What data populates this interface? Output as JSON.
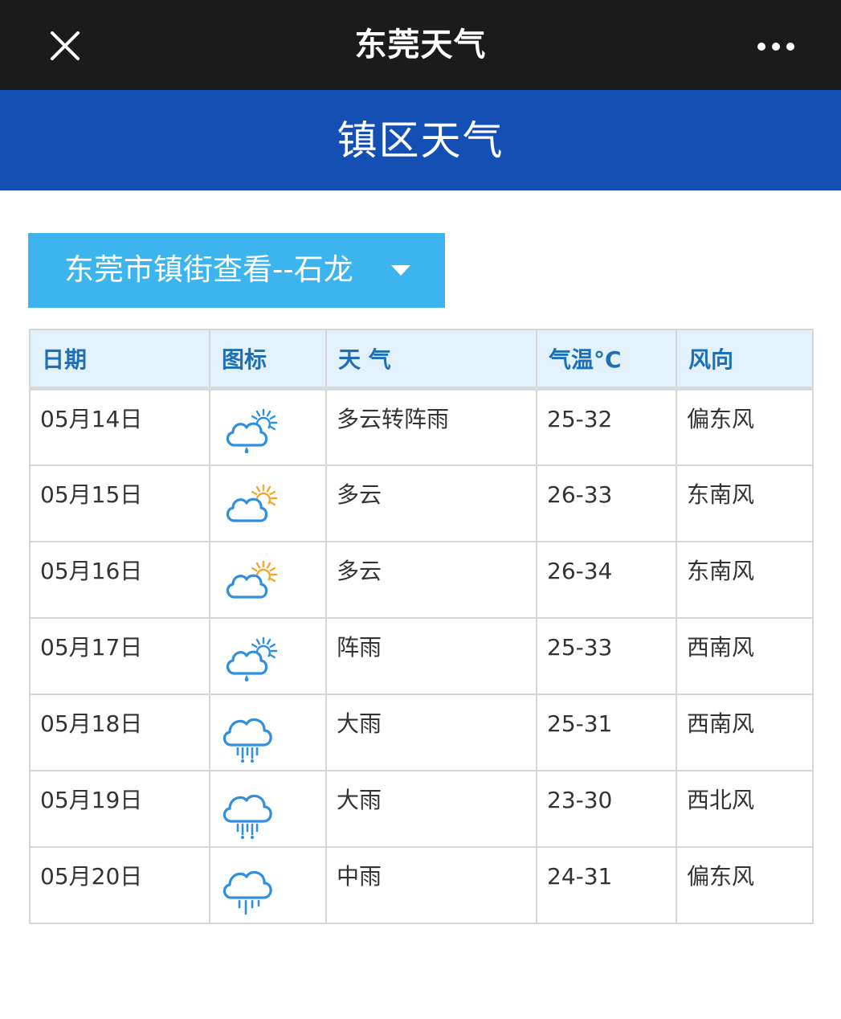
{
  "app_title": "东莞天气",
  "page_header": "镇区天气",
  "town_selector": {
    "label": "东莞市镇街查看--石龙"
  },
  "table": {
    "columns": [
      "日期",
      "图标",
      "天 气",
      "气温°C",
      "风向"
    ],
    "rows": [
      {
        "date": "05月14日",
        "icon": "cloud-sun-drizzle-icon",
        "weather": "多云转阵雨",
        "temp": "25-32",
        "wind": "偏东风"
      },
      {
        "date": "05月15日",
        "icon": "partly-cloudy-icon",
        "weather": "多云",
        "temp": "26-33",
        "wind": "东南风"
      },
      {
        "date": "05月16日",
        "icon": "partly-cloudy-icon",
        "weather": "多云",
        "temp": "26-34",
        "wind": "东南风"
      },
      {
        "date": "05月17日",
        "icon": "cloud-sun-drizzle-icon",
        "weather": "阵雨",
        "temp": "25-33",
        "wind": "西南风"
      },
      {
        "date": "05月18日",
        "icon": "heavy-rain-icon",
        "weather": "大雨",
        "temp": "25-31",
        "wind": "西南风"
      },
      {
        "date": "05月19日",
        "icon": "heavy-rain-icon",
        "weather": "大雨",
        "temp": "23-30",
        "wind": "西北风"
      },
      {
        "date": "05月20日",
        "icon": "moderate-rain-icon",
        "weather": "中雨",
        "temp": "24-31",
        "wind": "偏东风"
      }
    ]
  },
  "colors": {
    "top_bar": "#1b1b1b",
    "header_blue": "#1450b4",
    "selector_blue": "#3db4ee",
    "table_header_bg": "#e3f1fb",
    "table_header_text": "#1e6fb5",
    "icon_blue": "#2f8fe0",
    "icon_sun": "#f0a830"
  }
}
